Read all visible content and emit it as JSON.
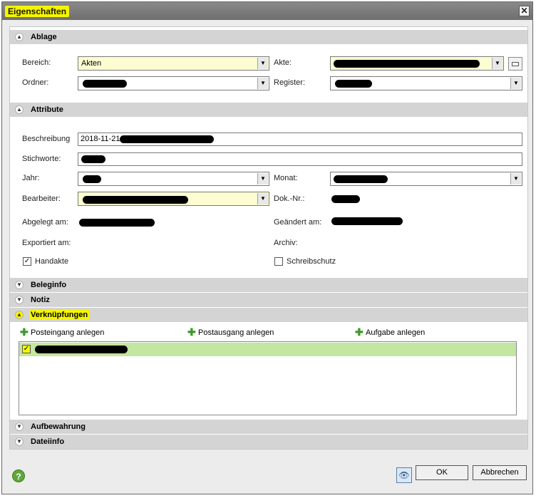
{
  "window": {
    "title": "Eigenschaften",
    "close_glyph": "✕"
  },
  "sections": {
    "ablage": "Ablage",
    "attribute": "Attribute",
    "beleginfo": "Beleginfo",
    "notiz": "Notiz",
    "verknuepfungen": "Verknüpfungen",
    "aufbewahrung": "Aufbewahrung",
    "dateiinfo": "Dateiinfo"
  },
  "ablage": {
    "bereich_label": "Bereich:",
    "bereich_value": "Akten",
    "akte_label": "Akte:",
    "ordner_label": "Ordner:",
    "register_label": "Register:"
  },
  "attribute": {
    "beschreibung_label": "Beschreibung",
    "beschreibung_value": "2018-11-21",
    "stichworte_label": "Stichworte:",
    "jahr_label": "Jahr:",
    "monat_label": "Monat:",
    "bearbeiter_label": "Bearbeiter:",
    "doknr_label": "Dok.-Nr.:",
    "abgelegt_label": "Abgelegt am:",
    "geaendert_label": "Geändert am:",
    "exportiert_label": "Exportiert am:",
    "archiv_label": "Archiv:",
    "handakte_label": "Handakte",
    "handakte_checked": true,
    "schreibschutz_label": "Schreibschutz",
    "schreibschutz_checked": false
  },
  "verknuepfungen": {
    "posteingang": "Posteingang anlegen",
    "postausgang": "Postausgang anlegen",
    "aufgabe": "Aufgabe anlegen"
  },
  "footer": {
    "ok": "OK",
    "cancel": "Abbrechen",
    "help_glyph": "?"
  },
  "colors": {
    "highlight": "#f5f500",
    "list_selection": "#c3e6a0",
    "field_yellow": "#fdfdd2"
  }
}
